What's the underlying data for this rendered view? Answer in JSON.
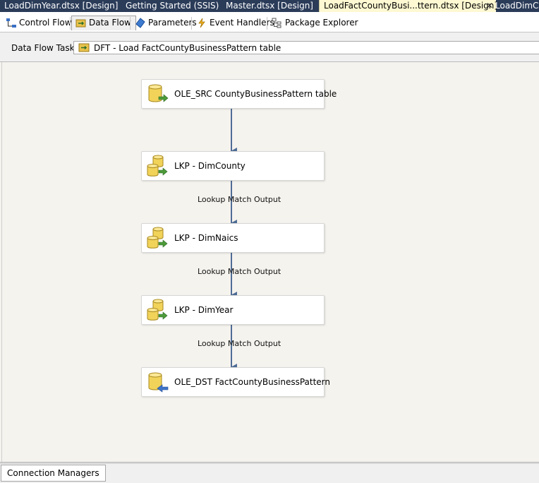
{
  "document_tabs": [
    {
      "label": "LoadDimYear.dtsx [Design]",
      "active": false
    },
    {
      "label": "Getting Started (SSIS)",
      "active": false
    },
    {
      "label": "Master.dtsx [Design]",
      "active": false
    },
    {
      "label": "LoadFactCountyBusi...ttern.dtsx [Design]",
      "active": true
    },
    {
      "label": "LoadDimCo",
      "active": false
    }
  ],
  "close_glyph": "✕",
  "designer_tabs": [
    {
      "label": "Control Flow",
      "icon": "control-flow-icon",
      "active": false
    },
    {
      "label": "Data Flow",
      "icon": "data-flow-icon",
      "active": true
    },
    {
      "label": "Parameters",
      "icon": "parameters-icon",
      "active": false
    },
    {
      "label": "Event Handlers",
      "icon": "event-handlers-icon",
      "active": false
    },
    {
      "label": "Package Explorer",
      "icon": "package-explorer-icon",
      "active": false
    }
  ],
  "task_bar": {
    "label": "Data Flow Task:",
    "selected_value": "DFT - Load FactCountyBusinessPattern table",
    "icon": "data-flow-task-icon"
  },
  "components": [
    {
      "label": "OLE_SRC CountyBusinessPattern table",
      "icon": "ole-db-source-icon"
    },
    {
      "label": "LKP - DimCounty",
      "icon": "lookup-icon"
    },
    {
      "label": "LKP - DimNaics",
      "icon": "lookup-icon"
    },
    {
      "label": "LKP - DimYear",
      "icon": "lookup-icon"
    },
    {
      "label": "OLE_DST FactCountyBusinessPattern",
      "icon": "ole-db-destination-icon"
    }
  ],
  "path_labels": [
    "Lookup Match Output",
    "Lookup Match Output",
    "Lookup Match Output"
  ],
  "connection_managers": {
    "tab_label": "Connection Managers"
  },
  "colors": {
    "tab_strip_bg": "#2b3c59",
    "active_tab_bg": "#fef9d2",
    "canvas_bg": "#f5f3ee",
    "connector": "#4f6d96"
  }
}
